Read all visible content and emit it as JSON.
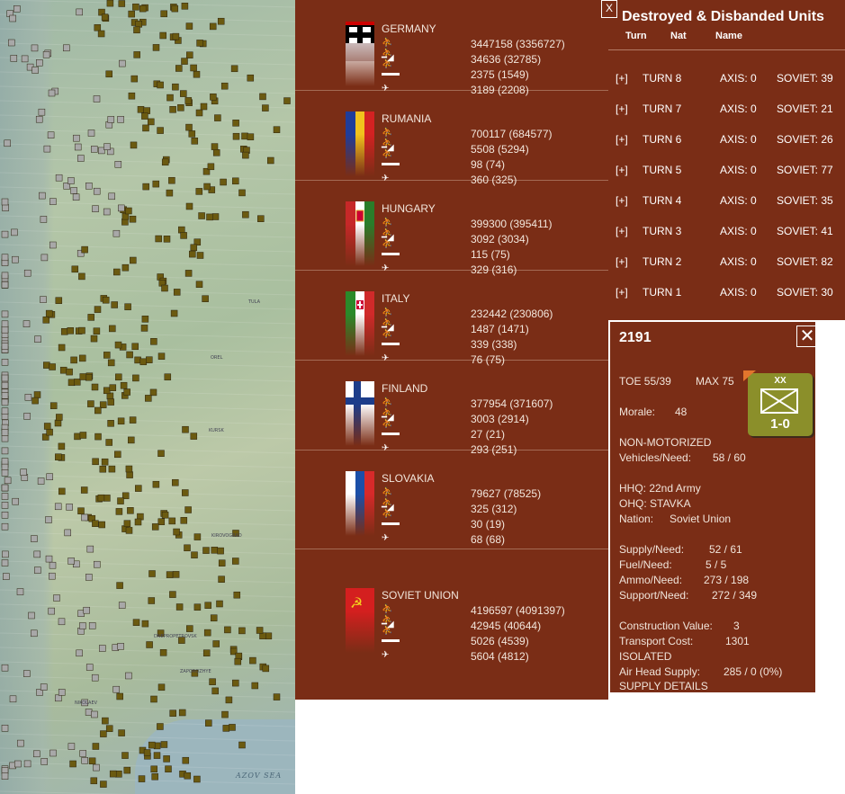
{
  "map": {
    "cities": [
      "KURSK",
      "OREL",
      "TULA",
      "DNEPROPETROVSK",
      "ZAPOROZHYE",
      "KIROVOGRAD",
      "NIKOLAEV"
    ],
    "sea_label": "AZOV SEA"
  },
  "nations": [
    {
      "name": "GERMANY",
      "flag": "germany",
      "men": "3447158 (3356727)",
      "guns": "34636 (32785)",
      "tanks": "2375 (1549)",
      "planes": "3189 (2208)"
    },
    {
      "name": "RUMANIA",
      "flag": "rumania",
      "men": "700117 (684577)",
      "guns": "5508 (5294)",
      "tanks": "98 (74)",
      "planes": "360 (325)"
    },
    {
      "name": "HUNGARY",
      "flag": "hungary",
      "men": "399300 (395411)",
      "guns": "3092 (3034)",
      "tanks": "115 (75)",
      "planes": "329 (316)"
    },
    {
      "name": "ITALY",
      "flag": "italy",
      "men": "232442 (230806)",
      "guns": "1487 (1471)",
      "tanks": "339 (338)",
      "planes": "76 (75)"
    },
    {
      "name": "FINLAND",
      "flag": "finland",
      "men": "377954 (371607)",
      "guns": "3003 (2914)",
      "tanks": "27 (21)",
      "planes": "293 (251)"
    },
    {
      "name": "SLOVAKIA",
      "flag": "slovakia",
      "men": "79627 (78525)",
      "guns": "325 (312)",
      "tanks": "30 (19)",
      "planes": "68 (68)"
    },
    {
      "name": "SOVIET UNION",
      "flag": "soviet",
      "men": "4196597 (4091397)",
      "guns": "42945 (40644)",
      "tanks": "5026 (4539)",
      "planes": "5604 (4812)"
    }
  ],
  "icons": {
    "men": "infantry-icon",
    "guns": "artillery-icon",
    "tanks": "tank-icon",
    "planes": "aircraft-icon"
  },
  "destroyed": {
    "title": "Destroyed & Disbanded Units",
    "headers": {
      "turn": "Turn",
      "nat": "Nat",
      "name": "Name"
    },
    "close": "X",
    "rows": [
      {
        "expand": "[+]",
        "turn": "TURN 8",
        "axis": "AXIS: 0",
        "soviet": "SOVIET: 39"
      },
      {
        "expand": "[+]",
        "turn": "TURN 7",
        "axis": "AXIS: 0",
        "soviet": "SOVIET: 21"
      },
      {
        "expand": "[+]",
        "turn": "TURN 6",
        "axis": "AXIS: 0",
        "soviet": "SOVIET: 26"
      },
      {
        "expand": "[+]",
        "turn": "TURN 5",
        "axis": "AXIS: 0",
        "soviet": "SOVIET: 77"
      },
      {
        "expand": "[+]",
        "turn": "TURN 4",
        "axis": "AXIS: 0",
        "soviet": "SOVIET: 35"
      },
      {
        "expand": "[+]",
        "turn": "TURN 3",
        "axis": "AXIS: 0",
        "soviet": "SOVIET: 41"
      },
      {
        "expand": "[+]",
        "turn": "TURN 2",
        "axis": "AXIS: 0",
        "soviet": "SOVIET: 82"
      },
      {
        "expand": "[+]",
        "turn": "TURN 1",
        "axis": "AXIS: 0",
        "soviet": "SOVIET: 30"
      }
    ]
  },
  "unit": {
    "id": "2191",
    "close": "✕",
    "toe": "TOE 55/39",
    "max": "MAX 75",
    "morale_label": "Morale:",
    "morale": "48",
    "counter_size": "XX",
    "counter_strength": "1-0",
    "motor": "NON-MOTORIZED",
    "vehicles_label": "Vehicles/Need:",
    "vehicles": "58 / 60",
    "hhq": "HHQ: 22nd Army",
    "ohq": "OHQ: STAVKA",
    "nation_label": "Nation:",
    "nation": "Soviet Union",
    "supply_label": "Supply/Need:",
    "supply": "52 / 61",
    "fuel_label": "Fuel/Need:",
    "fuel": "5 / 5",
    "ammo_label": "Ammo/Need:",
    "ammo": "273 / 198",
    "support_label": "Support/Need:",
    "support": "272 / 349",
    "construction_label": "Construction Value:",
    "construction": "3",
    "transport_label": "Transport Cost:",
    "transport": "1301",
    "isolated": "ISOLATED",
    "airhead_label": "Air Head Supply:",
    "airhead": "285 / 0 (0%)",
    "details": "SUPPLY DETAILS"
  },
  "colors": {
    "panel": "#7a2d16",
    "counter": "#8b8f2a",
    "unit_marker_axis": "#6b5a10",
    "unit_marker_soviet": "#a8a8a8"
  }
}
